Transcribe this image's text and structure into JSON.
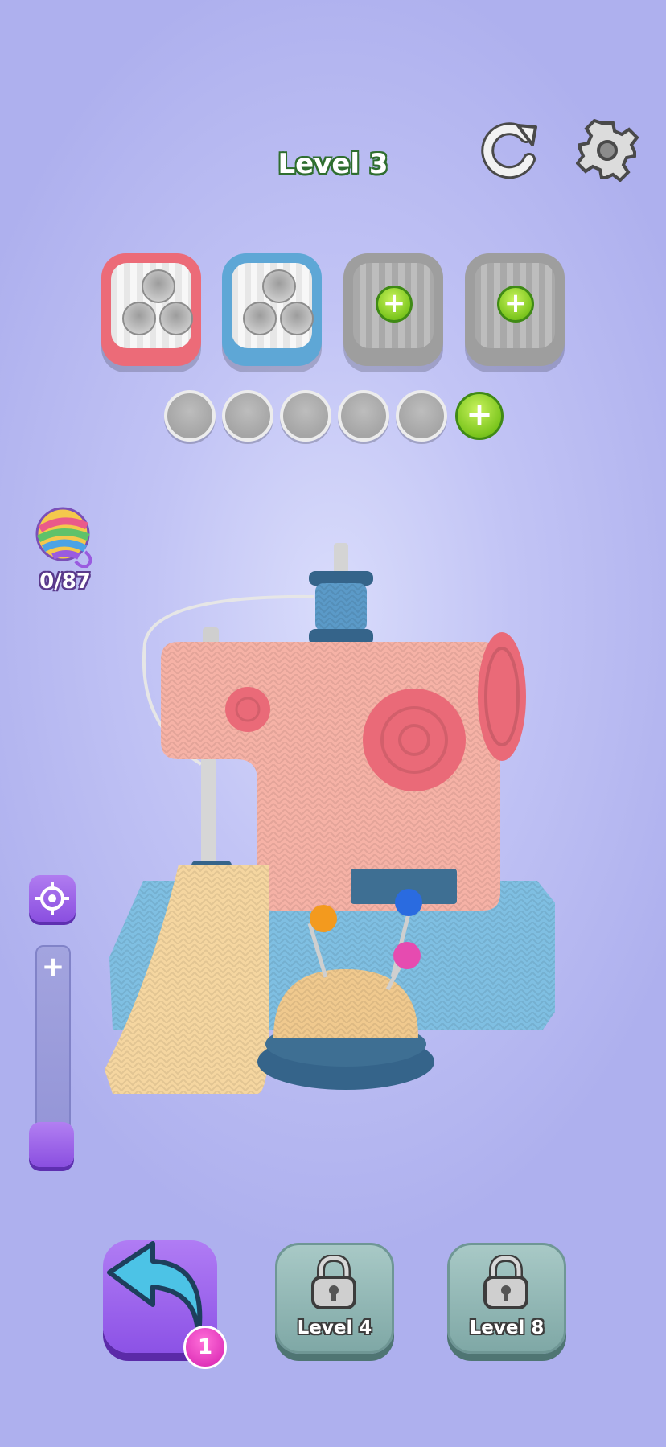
{
  "header": {
    "level_title": "Level 3",
    "restart_icon": "restart-icon",
    "settings_icon": "gear-icon"
  },
  "spool_holders": [
    {
      "color": "#ec6b78",
      "state": "open",
      "holes": 3
    },
    {
      "color": "#5ea7d6",
      "state": "open",
      "holes": 3
    },
    {
      "color": "#9e9e9e",
      "state": "locked",
      "icon": "plus-icon"
    },
    {
      "color": "#9e9e9e",
      "state": "locked",
      "icon": "plus-icon"
    }
  ],
  "slots": {
    "empty_count": 5,
    "add_icon": "plus-icon"
  },
  "yarn": {
    "icon": "yarn-ball-icon",
    "count": "0/87"
  },
  "zoom": {
    "focus_icon": "target-icon",
    "plus_label": "+",
    "level_fraction": 0.0
  },
  "scene": {
    "subject": "knitted sewing machine",
    "colors": {
      "body": "#f6b2a6",
      "wheel": "#ea6a78",
      "base": "#7fbfe2",
      "fabric": "#f5d6a0",
      "pincushion": "#f0c98e",
      "spool": "#5b8fb8"
    }
  },
  "bottom": {
    "undo_icon": "undo-arrow-icon",
    "undo_badge": "1",
    "locked_buttons": [
      {
        "label": "Level 4",
        "icon": "lock-icon"
      },
      {
        "label": "Level 8",
        "icon": "lock-icon"
      }
    ]
  }
}
